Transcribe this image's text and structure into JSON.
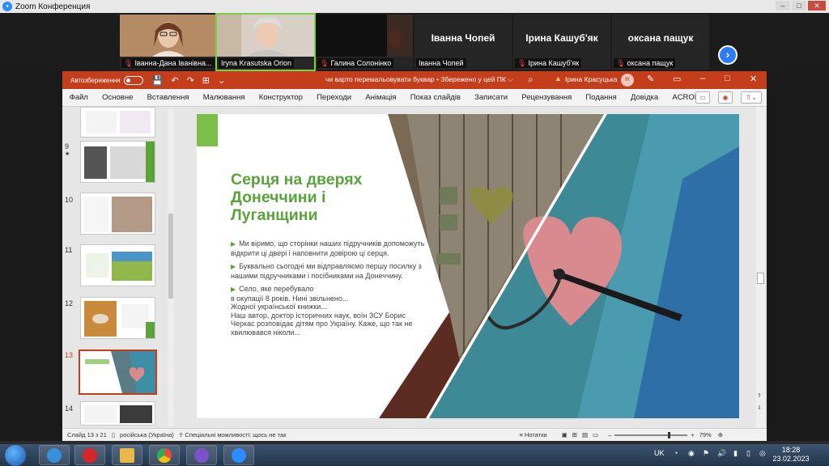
{
  "zoom": {
    "window_title": "Zoom Конференция",
    "participants": [
      {
        "name": "Іванна-Дана Іванівна...",
        "muted": true,
        "video": true
      },
      {
        "name": "Iryna Krasutska Orion",
        "muted": false,
        "video": true,
        "active": true
      },
      {
        "name": "Галина Солонінко",
        "muted": true,
        "video": true
      },
      {
        "name": "Іванна Чопей",
        "display": "Іванна Чопей",
        "muted": false,
        "video": false
      },
      {
        "name": "Ірина Кашуб'як",
        "display": "Ірина Кашуб'як",
        "muted": true,
        "video": false
      },
      {
        "name": "оксана пащук",
        "display": "оксана пащук",
        "muted": true,
        "video": false
      }
    ],
    "next_page_icon": "chevron-right-icon"
  },
  "powerpoint": {
    "autosave_label": "Автозбереження",
    "doc_name": "чи варто перемальовувати буквар • Збережено у цей ПК ⌵",
    "user_name": "Ірина Красуцька",
    "user_initials": "ІК",
    "accent_color": "#c43e1c",
    "ribbon_tabs": [
      "Файл",
      "Основне",
      "Вставлення",
      "Малювання",
      "Конструктор",
      "Переходи",
      "Анімація",
      "Показ слайдів",
      "Записати",
      "Рецензування",
      "Подання",
      "Довідка",
      "ACROBAT"
    ],
    "thumbnails": [
      {
        "num": ""
      },
      {
        "num": "9",
        "star": "★"
      },
      {
        "num": "10"
      },
      {
        "num": "11"
      },
      {
        "num": "12"
      },
      {
        "num": "13",
        "selected": true
      },
      {
        "num": "14"
      }
    ],
    "slide": {
      "title": "Серця на дверях Донеччини і Луганщини",
      "bullets": [
        "Ми віримо, що сторінки наших підручників допоможуть відкрити ці двері і наповнити довірою ці серця.",
        "Буквально сьогодні ми відправляємо першу посилку з нашими підручниками і посібниками на Донеччину.",
        "Село, яке перебувало\nв окупації 8 років. Нині звільнено...\nЖодної української книжки...\nНаш автор, доктор історичних наук, воїн ЗСУ Борис Черкас розповідає дітям про Україну. Каже, що так не хвилювався ніколи..."
      ],
      "title_color": "#5aa23a"
    },
    "status": {
      "slide_info": "Слайд 13 з 21",
      "language": "російська (Україна)",
      "accessibility": "Спеціальні можливості: щось не так",
      "notes": "Нотатки",
      "zoom_level": "79%"
    }
  },
  "taskbar": {
    "lang": "UK",
    "time": "18:28",
    "date": "23.02.2023"
  }
}
